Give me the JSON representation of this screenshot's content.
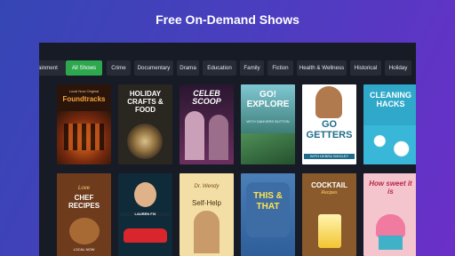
{
  "header": {
    "title": "Free On-Demand Shows"
  },
  "categories": [
    {
      "label": "rtainment",
      "active": false
    },
    {
      "label": "All Shows",
      "active": true
    },
    {
      "label": "Crime",
      "active": false
    },
    {
      "label": "Documentary",
      "active": false
    },
    {
      "label": "Drama",
      "active": false
    },
    {
      "label": "Education",
      "active": false
    },
    {
      "label": "Family",
      "active": false
    },
    {
      "label": "Fiction",
      "active": false
    },
    {
      "label": "Health & Wellness",
      "active": false
    },
    {
      "label": "Historical",
      "active": false
    },
    {
      "label": "Holiday",
      "active": false
    }
  ],
  "shows": [
    {
      "pre": "Local Now Original",
      "title": "Foundtracks",
      "sub": "",
      "bg": "#3a1a0e",
      "accent": "#e8731f"
    },
    {
      "pre": "",
      "title": "HOLIDAY CRAFTS & FOOD",
      "sub": "",
      "bg": "#2a2620",
      "accent": "#c7a56b"
    },
    {
      "pre": "",
      "title": "CELEB SCOOP",
      "sub": "",
      "bg": "#3b1f3f",
      "accent": "#e04fa0"
    },
    {
      "pre": "",
      "title": "GO! EXPLORE",
      "sub": "WITH DANVERS BUTTON",
      "bg": "#2d6d7e",
      "accent": "#7fd0d4"
    },
    {
      "pre": "",
      "title": "GO GETTERS",
      "sub": "WITH DEBRA SHIGLEY",
      "bg": "#ffffff",
      "accent": "#1f6c8a"
    },
    {
      "pre": "",
      "title": "CLEANING HACKS",
      "sub": "",
      "bg": "#2fa8c9",
      "accent": "#ffffff"
    },
    {
      "pre": "Love",
      "title": "CHEF RECIPES",
      "sub": "LOCAL NOW",
      "bg": "#6e3c1d",
      "accent": "#f3d27a"
    },
    {
      "pre": "",
      "title": "",
      "sub": "LAUREN FIX",
      "bg": "#0f2a38",
      "accent": "#d9262c"
    },
    {
      "pre": "Dr. Wendy",
      "title": "Self-Help",
      "sub": "",
      "bg": "#f3dfa5",
      "accent": "#7a4b1c"
    },
    {
      "pre": "",
      "title": "THIS & THAT",
      "sub": "",
      "bg": "#4a7fb8",
      "accent": "#ffe34d"
    },
    {
      "pre": "",
      "title": "COCKTAIL",
      "sub": "Recipes",
      "bg": "#8a5a2c",
      "accent": "#ffd76a"
    },
    {
      "pre": "",
      "title": "How sweet it is",
      "sub": "",
      "bg": "#f4c5cd",
      "accent": "#b8284a"
    }
  ],
  "icons": [
    "foundtracks-art",
    "crafts-art",
    "celeb-art",
    "explore-art",
    "gogetters-art",
    "cleaning-art",
    "chef-art",
    "laurenfix-art",
    "selfhelp-art",
    "thisthat-art",
    "cocktail-art",
    "sweet-art"
  ]
}
